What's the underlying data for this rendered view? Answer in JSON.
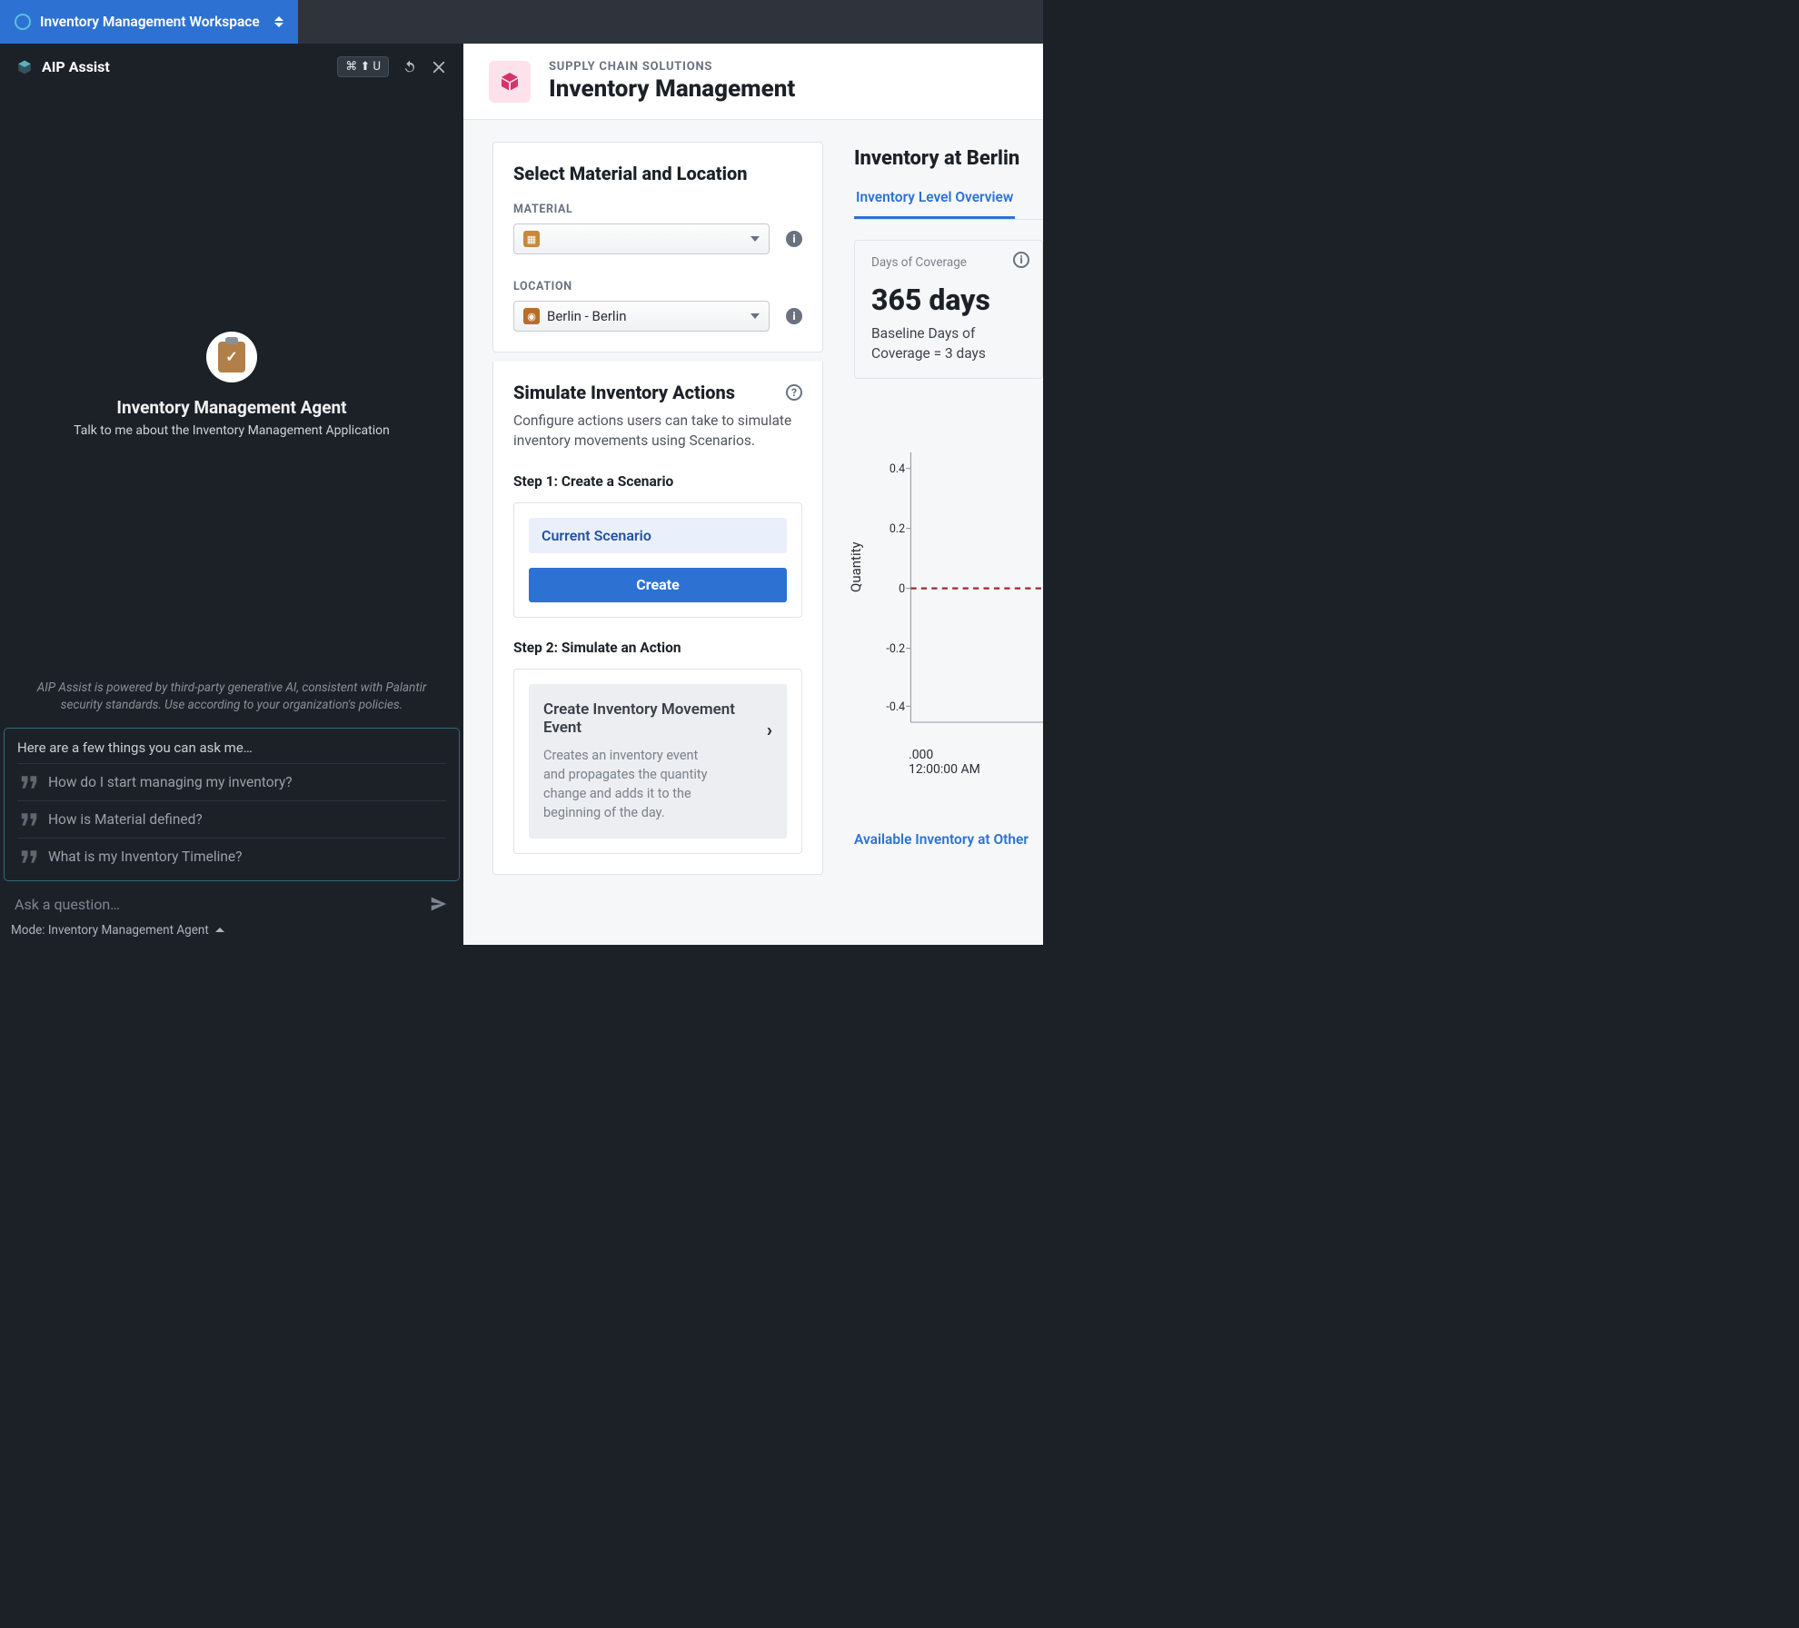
{
  "topbar": {
    "workspace_label": "Inventory Management Workspace"
  },
  "aip": {
    "title": "AIP Assist",
    "shortcut_glyphs": "⌘ ⬆ U",
    "agent_title": "Inventory Management Agent",
    "agent_sub": "Talk to me about the Inventory Management Application",
    "disclaimer": "AIP Assist is powered by third-party generative AI, consistent with Palantir security standards. Use according to your organization's policies.",
    "suggest_heading": "Here are a few things you can ask me…",
    "suggestions": [
      "How do I start managing my inventory?",
      "How is Material defined?",
      "What is my Inventory Timeline?"
    ],
    "ask_placeholder": "Ask a question…",
    "mode_label": "Mode: Inventory Management Agent"
  },
  "page": {
    "eyebrow": "SUPPLY CHAIN SOLUTIONS",
    "title": "Inventory Management"
  },
  "select_section": {
    "title": "Select Material and Location",
    "material_label": "MATERIAL",
    "material_value": "",
    "location_label": "LOCATION",
    "location_value": "Berlin - Berlin"
  },
  "simulate": {
    "title": "Simulate Inventory Actions",
    "desc": "Configure actions users can take to simulate inventory movements using Scenarios.",
    "step1": "Step 1: Create a Scenario",
    "scenario_label": "Current Scenario",
    "create_label": "Create",
    "step2": "Step 2: Simulate an Action",
    "movement_title": "Create Inventory Movement Event",
    "movement_desc": "Creates an inventory event and propagates the quantity change and adds it to the beginning of the day."
  },
  "inventory": {
    "title": "Inventory at Berlin",
    "tab": "Inventory Level Overview",
    "metric_label": "Days of Coverage",
    "metric_value": "365 days",
    "metric_sub": "Baseline Days of Coverage = 3 days",
    "chart_ylabel": "Quantity",
    "chart_x_tick": ".000",
    "chart_x_sub": "12:00:00 AM",
    "link": "Available Inventory at Other"
  },
  "chart_data": {
    "type": "line",
    "title": "",
    "xlabel": "",
    "ylabel": "Quantity",
    "ylim": [
      -0.5,
      0.5
    ],
    "y_ticks": [
      -0.4,
      -0.2,
      0,
      0.2,
      0.4
    ],
    "x_ticks": [
      ".000"
    ],
    "x_tick_sub": [
      "12:00:00 AM"
    ],
    "series": [
      {
        "name": "baseline",
        "style": "dashed",
        "color": "#9d2b2b",
        "values": [
          0,
          0
        ]
      }
    ]
  }
}
